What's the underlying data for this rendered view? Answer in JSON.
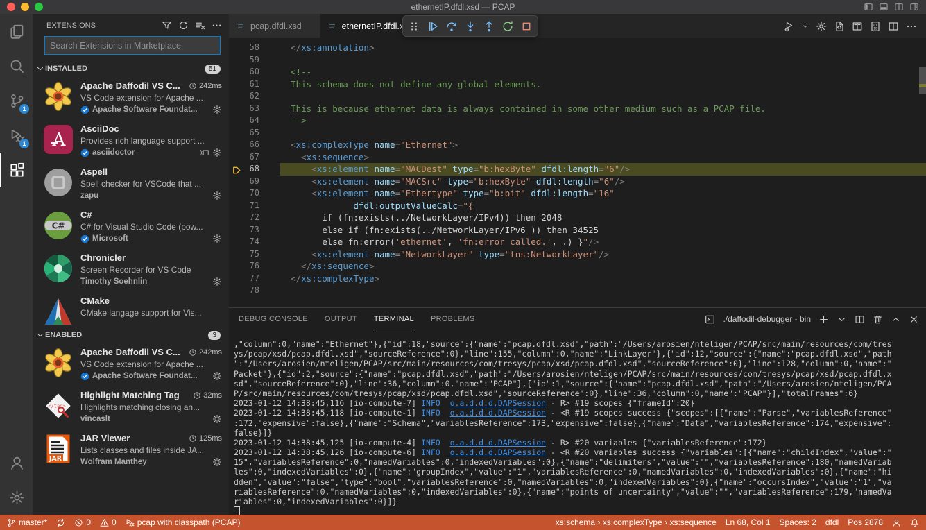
{
  "colors": {
    "accent": "#007fd4",
    "badge": "#2f86d1",
    "status_debug": "#c4532e",
    "current_line": "#4b4b21",
    "traffic": [
      "#ff5f57",
      "#febc2e",
      "#28c840"
    ]
  },
  "window": {
    "title": "ethernetIP.dfdl.xsd — PCAP",
    "traffic_lights": [
      {
        "id": "close"
      },
      {
        "id": "minimize"
      },
      {
        "id": "zoom"
      }
    ],
    "controls": [
      "toggle-sidebar-icon",
      "toggle-panel-icon",
      "toggle-secondary-sidebar-icon",
      "customize-layout-icon"
    ]
  },
  "activity_bar": {
    "items": [
      {
        "id": "explorer",
        "icon": "files-icon"
      },
      {
        "id": "search",
        "icon": "search-icon"
      },
      {
        "id": "source-control",
        "icon": "source-control-icon",
        "badge": "1"
      },
      {
        "id": "run-debug",
        "icon": "debug-icon",
        "badge": "1"
      },
      {
        "id": "extensions",
        "icon": "extensions-icon",
        "active": true
      }
    ],
    "bottom": [
      {
        "id": "accounts",
        "icon": "account-icon"
      },
      {
        "id": "settings",
        "icon": "gear-icon"
      }
    ]
  },
  "sidebar": {
    "title": "EXTENSIONS",
    "actions": [
      "filter-icon",
      "refresh-icon",
      "clear-all-icon",
      "more-icon"
    ],
    "search_placeholder": "Search Extensions in Marketplace",
    "sections": [
      {
        "label": "INSTALLED",
        "badge": "51",
        "clip": true,
        "items": [
          {
            "logo": "daffodil-logo",
            "name": "Apache Daffodil VS C...",
            "time": "242ms",
            "desc": "VS Code extension for Apache ...",
            "publisher": "Apache Software Foundat...",
            "verified": true,
            "gear": true
          },
          {
            "logo": "asciidoc-logo",
            "name": "AsciiDoc",
            "time": "",
            "desc": "Provides rich language support ...",
            "publisher": "asciidoctor",
            "verified": true,
            "extra": "preview-icon",
            "gear": true
          },
          {
            "logo": "aspell-logo",
            "name": "Aspell",
            "time": "",
            "desc": "Spell checker for VSCode that ...",
            "publisher": "zapu",
            "verified": false,
            "gear": true
          },
          {
            "logo": "csharp-logo",
            "name": "C#",
            "time": "",
            "desc": "C# for Visual Studio Code (pow...",
            "publisher": "Microsoft",
            "verified": true,
            "gear": true
          },
          {
            "logo": "chronicler-logo",
            "name": "Chronicler",
            "time": "",
            "desc": "Screen Recorder for VS Code",
            "publisher": "Timothy Soehnlin",
            "verified": false,
            "gear": true
          },
          {
            "logo": "cmake-logo",
            "name": "CMake",
            "time": "",
            "desc": "CMake langage support for Vis...",
            "publisher": "",
            "verified": false,
            "gear": false
          }
        ]
      },
      {
        "label": "ENABLED",
        "badge": "3",
        "clip": false,
        "items": [
          {
            "logo": "daffodil-logo",
            "name": "Apache Daffodil VS C...",
            "time": "242ms",
            "desc": "VS Code extension for Apache ...",
            "publisher": "Apache Software Foundat...",
            "verified": true,
            "gear": true
          },
          {
            "logo": "hmt-logo",
            "name": "Highlight Matching Tag",
            "time": "32ms",
            "desc": "Highlights matching closing an...",
            "publisher": "vincaslt",
            "verified": false,
            "gear": true
          },
          {
            "logo": "jar-logo",
            "name": "JAR Viewer",
            "time": "125ms",
            "desc": "Lists classes and files inside JA...",
            "publisher": "Wolfram Manthey",
            "verified": false,
            "gear": true
          }
        ]
      }
    ]
  },
  "editor": {
    "tabs": [
      {
        "label": "pcap.dfdl.xsd",
        "icon": "file-lines-icon",
        "active": false
      },
      {
        "label": "ethernetIP.dfdl.xsd",
        "icon": "file-lines-icon",
        "active": true
      }
    ],
    "toolbar": [
      {
        "icon": "grip-icon",
        "cls": "dim",
        "id": "drag-handle"
      },
      {
        "icon": "continue-icon",
        "cls": "blu",
        "id": "continue"
      },
      {
        "icon": "step-over-icon",
        "cls": "blu",
        "id": "step-over"
      },
      {
        "icon": "step-into-icon",
        "cls": "blu",
        "id": "step-into"
      },
      {
        "icon": "step-out-icon",
        "cls": "blu",
        "id": "step-out"
      },
      {
        "icon": "restart-icon",
        "cls": "grn",
        "id": "restart"
      },
      {
        "icon": "stop-icon",
        "cls": "red",
        "id": "stop"
      }
    ],
    "actions": [
      "run-select-icon",
      "chevron-down-icon",
      "gear-icon",
      "file-code-icon",
      "book-icon",
      "binary-icon",
      "split-editor-icon",
      "more-icon"
    ],
    "current_line": "68",
    "lines": [
      {
        "n": "58",
        "s": [
          [
            "w",
            "  "
          ],
          [
            "p",
            "</"
          ],
          [
            "t",
            "xs:annotation"
          ],
          [
            "p",
            ">"
          ]
        ]
      },
      {
        "n": "59",
        "s": []
      },
      {
        "n": "60",
        "s": [
          [
            "c",
            "  <!--"
          ]
        ]
      },
      {
        "n": "61",
        "s": [
          [
            "c",
            "  This schema does not define any global elements."
          ]
        ]
      },
      {
        "n": "62",
        "s": []
      },
      {
        "n": "63",
        "s": [
          [
            "c",
            "  This is because ethernet data is always contained in some other medium such as a PCAP file."
          ]
        ]
      },
      {
        "n": "64",
        "s": [
          [
            "c",
            "  -->"
          ]
        ]
      },
      {
        "n": "65",
        "s": []
      },
      {
        "n": "66",
        "s": [
          [
            "w",
            "  "
          ],
          [
            "p",
            "<"
          ],
          [
            "t",
            "xs:complexType"
          ],
          [
            "w",
            " "
          ],
          [
            "a",
            "name"
          ],
          [
            "p",
            "="
          ],
          [
            "s",
            "\"Ethernet\""
          ],
          [
            "p",
            ">"
          ]
        ]
      },
      {
        "n": "67",
        "s": [
          [
            "w",
            "    "
          ],
          [
            "p",
            "<"
          ],
          [
            "t",
            "xs:sequence"
          ],
          [
            "p",
            ">"
          ]
        ]
      },
      {
        "n": "68",
        "current": true,
        "s": [
          [
            "w",
            "      "
          ],
          [
            "p",
            "<"
          ],
          [
            "t",
            "xs:element"
          ],
          [
            "w",
            " "
          ],
          [
            "a",
            "name"
          ],
          [
            "p",
            "="
          ],
          [
            "s",
            "\"MACDest\""
          ],
          [
            "w",
            " "
          ],
          [
            "a",
            "type"
          ],
          [
            "p",
            "="
          ],
          [
            "s",
            "\"b:hexByte\""
          ],
          [
            "w",
            " "
          ],
          [
            "a",
            "dfdl:length"
          ],
          [
            "p",
            "="
          ],
          [
            "s",
            "\"6\""
          ],
          [
            "p",
            "/>"
          ]
        ]
      },
      {
        "n": "69",
        "s": [
          [
            "w",
            "      "
          ],
          [
            "p",
            "<"
          ],
          [
            "t",
            "xs:element"
          ],
          [
            "w",
            " "
          ],
          [
            "a",
            "name"
          ],
          [
            "p",
            "="
          ],
          [
            "s",
            "\"MACSrc\""
          ],
          [
            "w",
            " "
          ],
          [
            "a",
            "type"
          ],
          [
            "p",
            "="
          ],
          [
            "s",
            "\"b:hexByte\""
          ],
          [
            "w",
            " "
          ],
          [
            "a",
            "dfdl:length"
          ],
          [
            "p",
            "="
          ],
          [
            "s",
            "\"6\""
          ],
          [
            "p",
            "/>"
          ]
        ]
      },
      {
        "n": "70",
        "s": [
          [
            "w",
            "      "
          ],
          [
            "p",
            "<"
          ],
          [
            "t",
            "xs:element"
          ],
          [
            "w",
            " "
          ],
          [
            "a",
            "name"
          ],
          [
            "p",
            "="
          ],
          [
            "s",
            "\"Ethertype\""
          ],
          [
            "w",
            " "
          ],
          [
            "a",
            "type"
          ],
          [
            "p",
            "="
          ],
          [
            "s",
            "\"b:bit\""
          ],
          [
            "w",
            " "
          ],
          [
            "a",
            "dfdl:length"
          ],
          [
            "p",
            "="
          ],
          [
            "s",
            "\"16\""
          ]
        ]
      },
      {
        "n": "71",
        "s": [
          [
            "w",
            "              "
          ],
          [
            "a",
            "dfdl:outputValueCalc"
          ],
          [
            "p",
            "="
          ],
          [
            "s",
            "\"{"
          ]
        ]
      },
      {
        "n": "72",
        "s": [
          [
            "w",
            "        if (fn:exists(../NetworkLayer/IPv4)) then 2048"
          ]
        ]
      },
      {
        "n": "73",
        "s": [
          [
            "w",
            "        else if (fn:exists(../NetworkLayer/IPv6 )) then 34525"
          ]
        ]
      },
      {
        "n": "74",
        "s": [
          [
            "w",
            "        else fn:error("
          ],
          [
            "s",
            "'ethernet'"
          ],
          [
            "w",
            ", "
          ],
          [
            "s",
            "'fn:error called.'"
          ],
          [
            "w",
            ", .) }"
          ],
          [
            "s",
            "\""
          ],
          [
            "p",
            "/>"
          ]
        ]
      },
      {
        "n": "75",
        "s": [
          [
            "w",
            "      "
          ],
          [
            "p",
            "<"
          ],
          [
            "t",
            "xs:element"
          ],
          [
            "w",
            " "
          ],
          [
            "a",
            "name"
          ],
          [
            "p",
            "="
          ],
          [
            "s",
            "\"NetworkLayer\""
          ],
          [
            "w",
            " "
          ],
          [
            "a",
            "type"
          ],
          [
            "p",
            "="
          ],
          [
            "s",
            "\"tns:NetworkLayer\""
          ],
          [
            "p",
            "/>"
          ]
        ]
      },
      {
        "n": "76",
        "s": [
          [
            "w",
            "    "
          ],
          [
            "p",
            "</"
          ],
          [
            "t",
            "xs:sequence"
          ],
          [
            "p",
            ">"
          ]
        ]
      },
      {
        "n": "77",
        "s": [
          [
            "w",
            "  "
          ],
          [
            "p",
            "</"
          ],
          [
            "t",
            "xs:complexType"
          ],
          [
            "p",
            ">"
          ]
        ]
      },
      {
        "n": "78",
        "s": []
      }
    ]
  },
  "panel": {
    "tabs": [
      {
        "label": "DEBUG CONSOLE",
        "active": false
      },
      {
        "label": "OUTPUT",
        "active": false
      },
      {
        "label": "TERMINAL",
        "active": true
      },
      {
        "label": "PROBLEMS",
        "active": false
      }
    ],
    "terminal_icon": "terminal-box-icon",
    "terminal_label": "./daffodil-debugger - bin",
    "controls": [
      "plus-icon",
      "chevron-down-icon",
      "split-panel-icon",
      "trash-icon",
      "chevron-up-icon",
      "close-icon"
    ],
    "lines": [
      {
        "s": [
          [
            "w",
            ",\"column\":0,\"name\":\"Ethernet\"},{\"id\":18,\"source\":{\"name\":\"pcap.dfdl.xsd\",\"path\":\"/Users/arosien/nteligen/PCAP/src/main/resources/com/tres"
          ]
        ]
      },
      {
        "s": [
          [
            "w",
            "ys/pcap/xsd/pcap.dfdl.xsd\",\"sourceReference\":0},\"line\":155,\"column\":0,\"name\":\"LinkLayer\"},{\"id\":12,\"source\":{\"name\":\"pcap.dfdl.xsd\",\"path"
          ]
        ]
      },
      {
        "s": [
          [
            "w",
            "\":\"/Users/arosien/nteligen/PCAP/src/main/resources/com/tresys/pcap/xsd/pcap.dfdl.xsd\",\"sourceReference\":0},\"line\":128,\"column\":0,\"name\":\""
          ]
        ]
      },
      {
        "s": [
          [
            "w",
            "Packet\"},{\"id\":2,\"source\":{\"name\":\"pcap.dfdl.xsd\",\"path\":\"/Users/arosien/nteligen/PCAP/src/main/resources/com/tresys/pcap/xsd/pcap.dfdl.x"
          ]
        ]
      },
      {
        "s": [
          [
            "w",
            "sd\",\"sourceReference\":0},\"line\":36,\"column\":0,\"name\":\"PCAP\"},{\"id\":1,\"source\":{\"name\":\"pcap.dfdl.xsd\",\"path\":\"/Users/arosien/nteligen/PCA"
          ]
        ]
      },
      {
        "s": [
          [
            "w",
            "P/src/main/resources/com/tresys/pcap/xsd/pcap.dfdl.xsd\",\"sourceReference\":0},\"line\":36,\"column\":0,\"name\":\"PCAP\"}],\"totalFrames\":6}"
          ]
        ]
      },
      {
        "s": [
          [
            "w",
            "2023-01-12 14:38:45,116 [io-compute-7] "
          ],
          [
            "i",
            "INFO"
          ],
          [
            "w",
            "  "
          ],
          [
            "l",
            "o.a.d.d.d.DAPSession"
          ],
          [
            "w",
            " - R> #19 scopes {\"frameId\":20}"
          ]
        ]
      },
      {
        "s": [
          [
            "w",
            "2023-01-12 14:38:45,118 [io-compute-1] "
          ],
          [
            "i",
            "INFO"
          ],
          [
            "w",
            "  "
          ],
          [
            "l",
            "o.a.d.d.d.DAPSession"
          ],
          [
            "w",
            " - <R #19 scopes success {\"scopes\":[{\"name\":\"Parse\",\"variablesReference\""
          ]
        ]
      },
      {
        "s": [
          [
            "w",
            ":172,\"expensive\":false},{\"name\":\"Schema\",\"variablesReference\":173,\"expensive\":false},{\"name\":\"Data\",\"variablesReference\":174,\"expensive\":"
          ]
        ]
      },
      {
        "s": [
          [
            "w",
            "false}]}"
          ]
        ]
      },
      {
        "s": [
          [
            "w",
            "2023-01-12 14:38:45,125 [io-compute-4] "
          ],
          [
            "i",
            "INFO"
          ],
          [
            "w",
            "  "
          ],
          [
            "l",
            "o.a.d.d.d.DAPSession"
          ],
          [
            "w",
            " - R> #20 variables {\"variablesReference\":172}"
          ]
        ]
      },
      {
        "s": [
          [
            "w",
            "2023-01-12 14:38:45,126 [io-compute-6] "
          ],
          [
            "i",
            "INFO"
          ],
          [
            "w",
            "  "
          ],
          [
            "l",
            "o.a.d.d.d.DAPSession"
          ],
          [
            "w",
            " - <R #20 variables success {\"variables\":[{\"name\":\"childIndex\",\"value\":\""
          ]
        ]
      },
      {
        "s": [
          [
            "w",
            "15\",\"variablesReference\":0,\"namedVariables\":0,\"indexedVariables\":0},{\"name\":\"delimiters\",\"value\":\"\",\"variablesReference\":180,\"namedVariab"
          ]
        ]
      },
      {
        "s": [
          [
            "w",
            "les\":0,\"indexedVariables\":0},{\"name\":\"groupIndex\",\"value\":\"1\",\"variablesReference\":0,\"namedVariables\":0,\"indexedVariables\":0},{\"name\":\"hi"
          ]
        ]
      },
      {
        "s": [
          [
            "w",
            "dden\",\"value\":\"false\",\"type\":\"bool\",\"variablesReference\":0,\"namedVariables\":0,\"indexedVariables\":0},{\"name\":\"occursIndex\",\"value\":\"1\",\"va"
          ]
        ]
      },
      {
        "s": [
          [
            "w",
            "riablesReference\":0,\"namedVariables\":0,\"indexedVariables\":0},{\"name\":\"points of uncertainty\",\"value\":\"\",\"variablesReference\":179,\"namedVa"
          ]
        ]
      },
      {
        "s": [
          [
            "w",
            "riables\":0,\"indexedVariables\":0}]}"
          ]
        ]
      },
      {
        "cursor": true,
        "s": []
      }
    ]
  },
  "status_bar": {
    "left": [
      {
        "id": "branch",
        "icon": "branch-icon",
        "label": "master*"
      },
      {
        "id": "sync",
        "icon": "sync-icon",
        "label": ""
      },
      {
        "id": "errors",
        "icon": "error-icon",
        "label": "0"
      },
      {
        "id": "warnings",
        "icon": "warning-icon",
        "label": "0"
      },
      {
        "id": "debug-config",
        "icon": "debug-status-icon",
        "label": "pcap with classpath (PCAP)"
      }
    ],
    "right": [
      {
        "id": "breadcrumb",
        "label": "xs:schema › xs:complexType › xs:sequence"
      },
      {
        "id": "cursor-position",
        "label": "Ln 68, Col 1"
      },
      {
        "id": "indentation",
        "label": "Spaces: 2"
      },
      {
        "id": "language-mode",
        "label": "dfdl"
      },
      {
        "id": "document-position",
        "label": "Pos 2878"
      },
      {
        "id": "feedback",
        "icon": "feedback-icon",
        "label": ""
      },
      {
        "id": "notifications",
        "icon": "bell-icon",
        "label": ""
      }
    ]
  }
}
